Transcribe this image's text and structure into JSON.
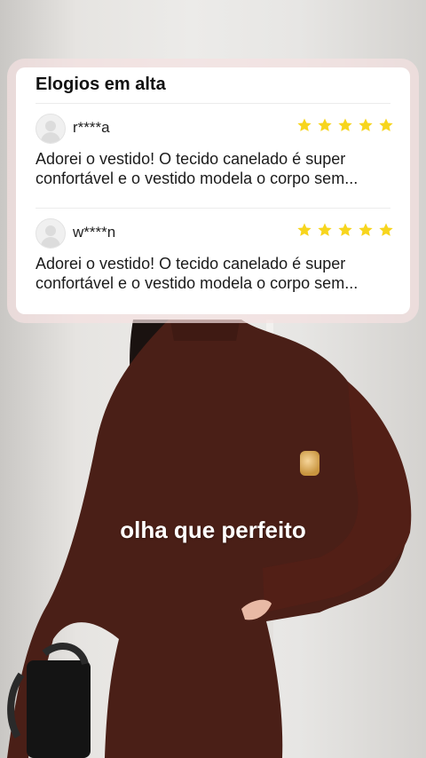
{
  "card": {
    "title": "Elogios em alta",
    "reviews": [
      {
        "username": "r****a",
        "stars": 5,
        "text": "Adorei o vestido! O tecido canelado é super confortável e o vestido modela o corpo sem..."
      },
      {
        "username": "w****n",
        "stars": 5,
        "text": "Adorei o vestido! O tecido canelado é super confortável e o vestido modela o corpo sem..."
      }
    ]
  },
  "caption": "olha que perfeito",
  "colors": {
    "star": "#f7d51d",
    "dress": "#4a1f17",
    "card_bg": "#ffffff"
  }
}
